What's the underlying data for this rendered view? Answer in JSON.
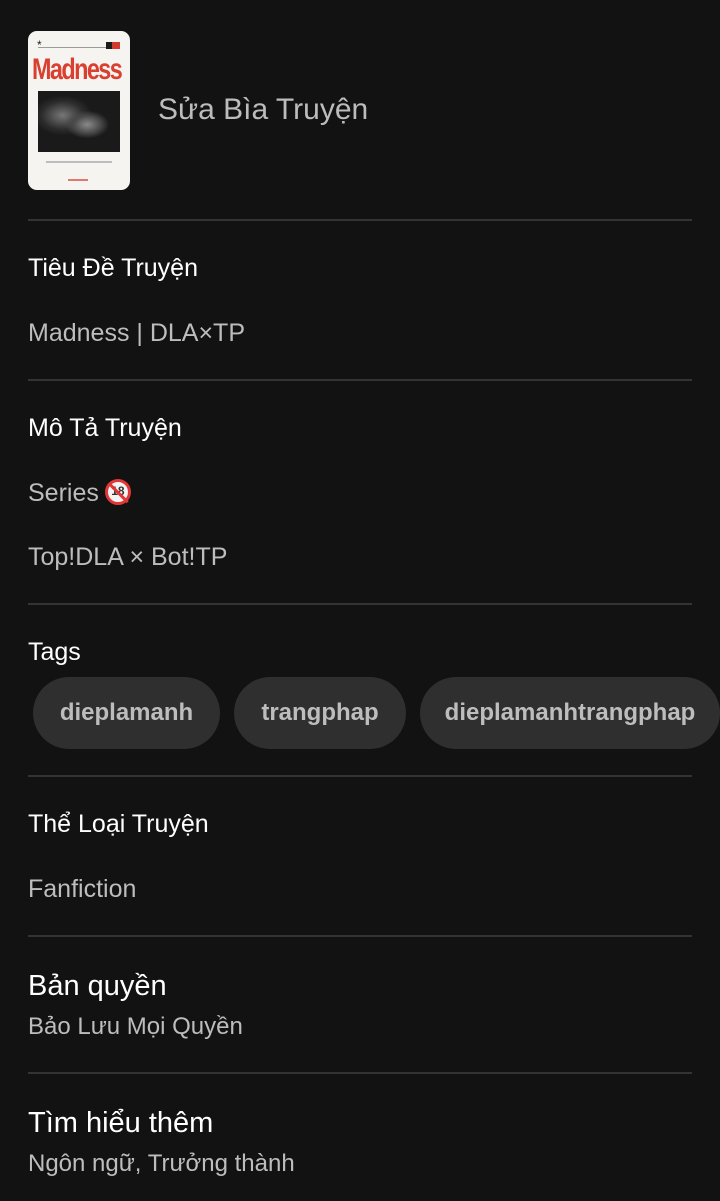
{
  "cover": {
    "image_title": "Madness",
    "edit_label": "Sửa Bìa Truyện"
  },
  "sections": {
    "title": {
      "label": "Tiêu Đề Truyện",
      "value": "Madness | DLA×TP"
    },
    "description": {
      "label": "Mô Tả Truyện",
      "line1": "Series",
      "badge": "18",
      "line2": "Top!DLA × Bot!TP"
    },
    "tags": {
      "label": "Tags",
      "items": [
        "dieplamanh",
        "trangphap",
        "dieplamanhtrangphap"
      ]
    },
    "category": {
      "label": "Thể Loại Truyện",
      "value": "Fanfiction"
    },
    "copyright": {
      "label": "Bản quyền",
      "value": "Bảo Lưu Mọi Quyền"
    },
    "learn_more": {
      "label": "Tìm hiểu thêm",
      "value": "Ngôn ngữ, Trưởng thành"
    }
  },
  "colors": {
    "background": "#121212",
    "divider": "#333333",
    "chip_bg": "#2f2f2f",
    "text_primary": "#ffffff",
    "text_secondary": "#bdbdbd"
  }
}
